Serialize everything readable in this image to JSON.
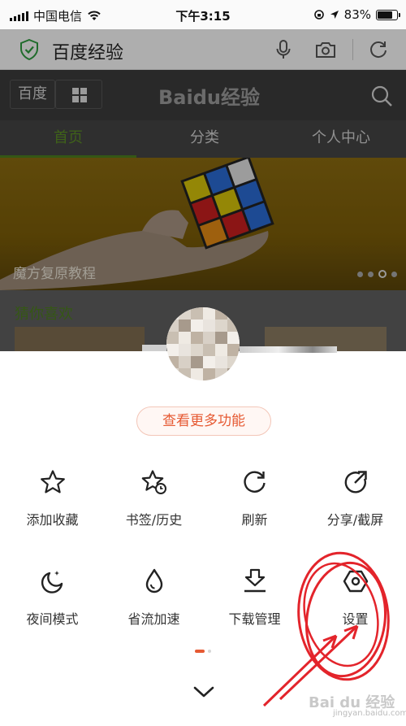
{
  "status_bar": {
    "carrier": "中国电信",
    "time": "下午3:15",
    "battery_percent": "83%",
    "battery_level": 0.83
  },
  "address_bar": {
    "title": "百度经验",
    "icons": [
      "shield-check-icon",
      "microphone-icon",
      "camera-icon",
      "reload-icon"
    ]
  },
  "site_header": {
    "left_button": "百度",
    "logo": "Baidu经验",
    "icons": [
      "grid-icon",
      "search-icon"
    ]
  },
  "tabs": [
    {
      "label": "首页",
      "active": true
    },
    {
      "label": "分类",
      "active": false
    },
    {
      "label": "个人中心",
      "active": false
    }
  ],
  "banner": {
    "caption": "魔方复原教程",
    "slide_count": 4,
    "active_slide": 3
  },
  "guess_section": {
    "title": "猜你喜欢"
  },
  "menu_sheet": {
    "more_button": "查看更多功能",
    "items": [
      {
        "label": "添加收藏",
        "icon": "star-icon"
      },
      {
        "label": "书签/历史",
        "icon": "bookmark-history-icon"
      },
      {
        "label": "刷新",
        "icon": "refresh-icon"
      },
      {
        "label": "分享/截屏",
        "icon": "share-icon"
      },
      {
        "label": "夜间模式",
        "icon": "night-mode-icon"
      },
      {
        "label": "省流加速",
        "icon": "data-saver-icon"
      },
      {
        "label": "下载管理",
        "icon": "download-icon"
      },
      {
        "label": "设置",
        "icon": "settings-icon"
      }
    ],
    "page_indicator": {
      "pages": 2,
      "current": 1
    },
    "collapse_icon": "chevron-down-icon"
  },
  "colors": {
    "accent": "#e65a33",
    "brand_green": "#4c7d1f",
    "annotation_red": "#e3242b"
  },
  "watermark": {
    "logo": "Bai du 经验",
    "sub": "jingyan.baidu.com"
  }
}
